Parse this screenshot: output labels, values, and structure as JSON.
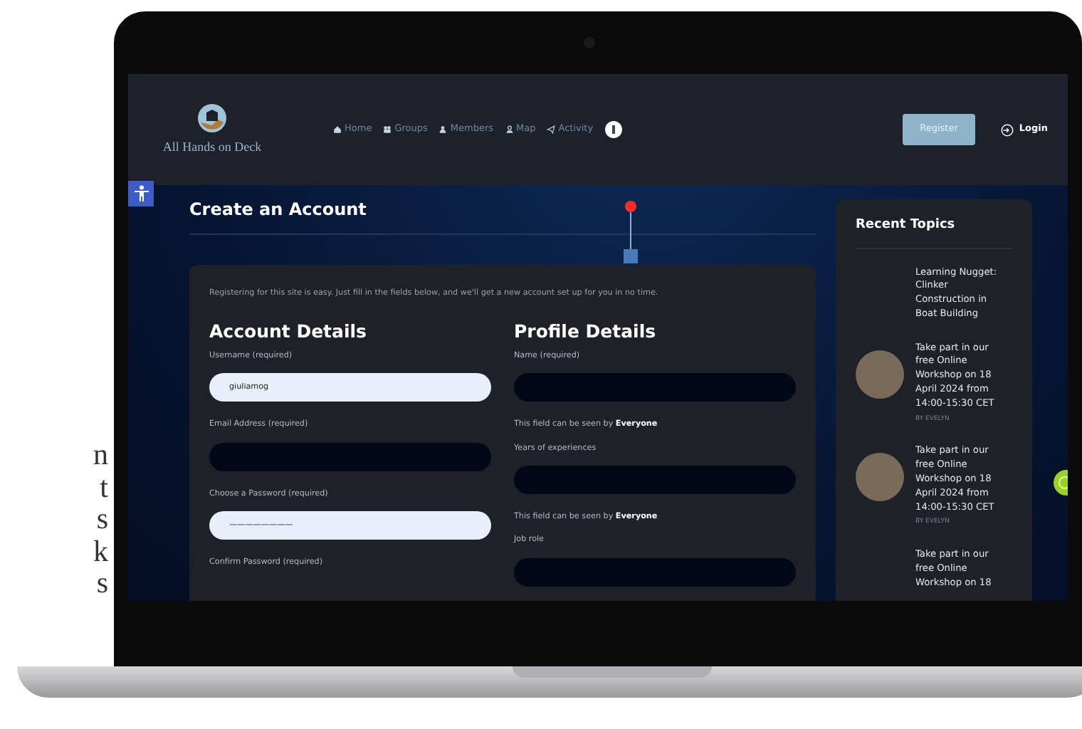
{
  "side_text": [
    "n",
    "t",
    "s",
    "k",
    "s"
  ],
  "site": {
    "logo_text": "All Hands on Deck"
  },
  "nav": [
    {
      "label": "Home"
    },
    {
      "label": "Groups"
    },
    {
      "label": "Members"
    },
    {
      "label": "Map"
    },
    {
      "label": "Activity"
    }
  ],
  "register_button": "Register",
  "login_link": "Login",
  "page_title": "Create an Account",
  "intro": "Registering for this site is easy. Just fill in the fields below, and we'll get a new account set up for you in no time.",
  "account": {
    "heading": "Account Details",
    "fields": [
      {
        "kind": "field",
        "label": "Username (required)",
        "value": "giuliamog"
      },
      {
        "kind": "field",
        "label": "Email Address (required)"
      },
      {
        "kind": "field",
        "label": "Choose a Password (required)",
        "value": "————————"
      },
      {
        "kind": "label",
        "label": "Confirm Password (required)"
      }
    ]
  },
  "profile": {
    "heading": "Profile Details",
    "fields": [
      {
        "kind": "field",
        "label": "Name (required)",
        "visibility_note": "This field can be seen by **Everyone**"
      },
      {
        "kind": "field",
        "label": "Years of experiences",
        "visibility_note": "This field can be seen by **Everyone**"
      },
      {
        "kind": "field",
        "label": "Job role"
      }
    ]
  },
  "sidebar": {
    "title": "Recent Topics",
    "topics": [
      {
        "title": "Learning Nugget: Clinker Construction in Boat Building",
        "avatar": false
      },
      {
        "title": "Take part in our free Online Workshop on 18 April 2024 from 14:00-15:30 CET",
        "author": "BY EVELYN",
        "avatar": true
      },
      {
        "title": "Take part in our free Online Workshop on 18 April 2024 from 14:00-15:30 CET",
        "author": "BY EVELYN",
        "avatar": true
      },
      {
        "title": "Take part in our free Online Workshop on 18",
        "avatar": false
      }
    ]
  }
}
